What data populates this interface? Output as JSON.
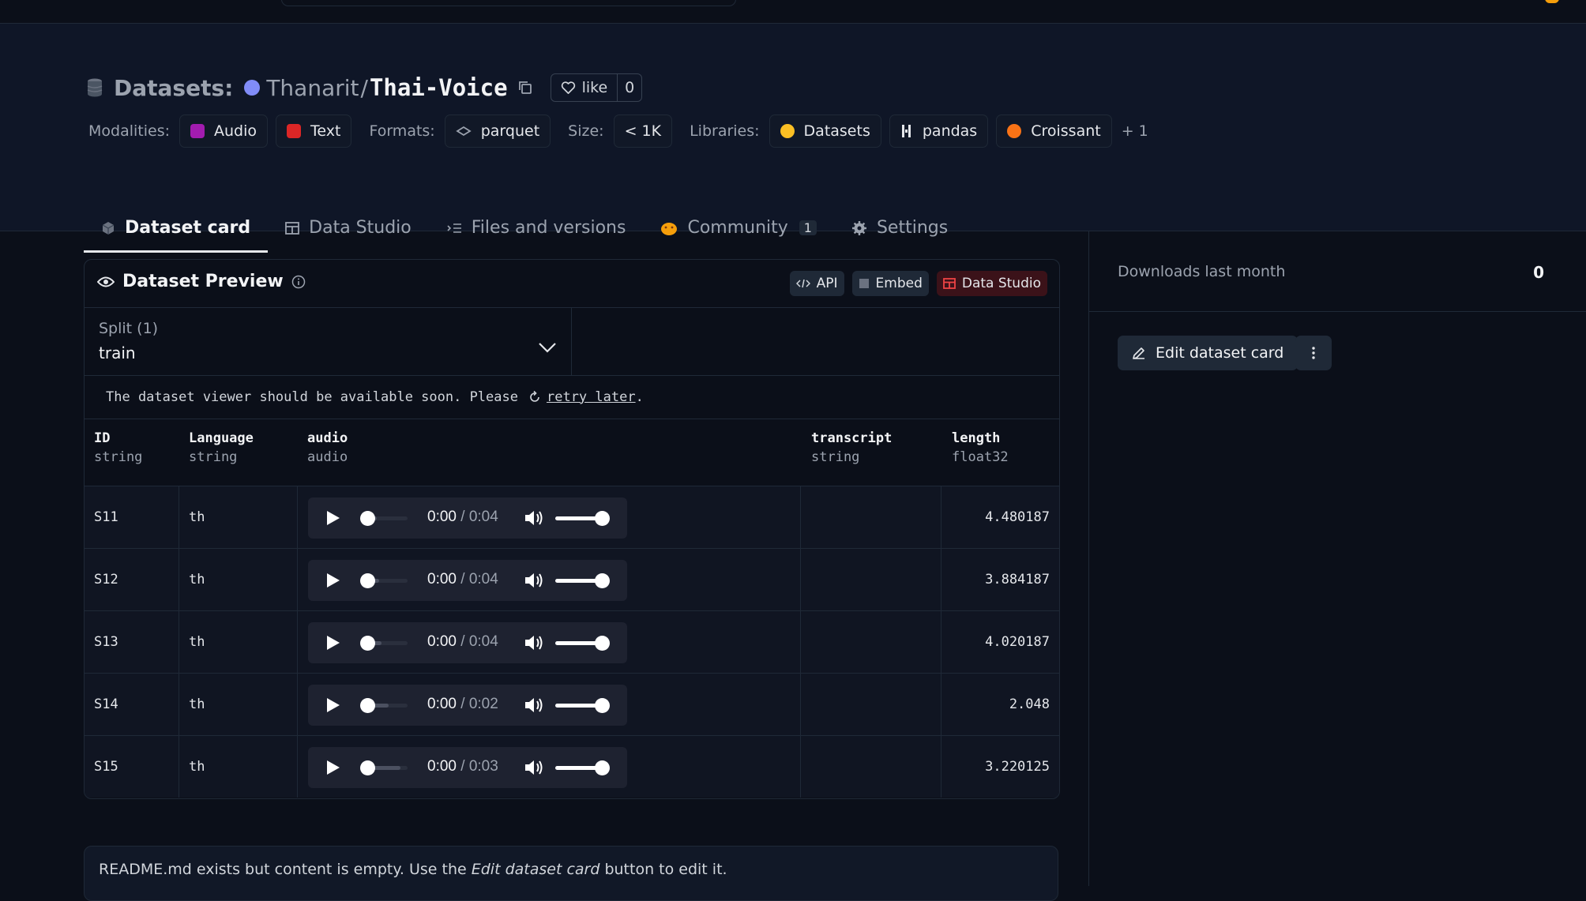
{
  "header": {
    "datasets_label": "Datasets:",
    "owner": "Thanarit",
    "separator": "/",
    "repo": "Thai-Voice",
    "like_label": "like",
    "like_count": "0"
  },
  "tags": {
    "modalities_label": "Modalities:",
    "modalities": [
      "Audio",
      "Text"
    ],
    "formats_label": "Formats:",
    "format": "parquet",
    "size_label": "Size:",
    "size": "< 1K",
    "libraries_label": "Libraries:",
    "libraries": [
      "Datasets",
      "pandas",
      "Croissant"
    ],
    "more": "+ 1"
  },
  "tabs": [
    {
      "label": "Dataset card",
      "active": true
    },
    {
      "label": "Data Studio"
    },
    {
      "label": "Files and versions"
    },
    {
      "label": "Community",
      "badge": "1"
    },
    {
      "label": "Settings"
    }
  ],
  "preview": {
    "title": "Dataset Preview",
    "api_label": "API",
    "embed_label": "Embed",
    "studio_label": "Data Studio",
    "split_label": "Split (1)",
    "split_value": "train",
    "notice_text": "The dataset viewer should be available soon. Please",
    "retry_text": "retry later",
    "notice_end": ".",
    "columns": [
      {
        "name": "ID",
        "type": "string"
      },
      {
        "name": "Language",
        "type": "string"
      },
      {
        "name": "audio",
        "type": "audio"
      },
      {
        "name": "transcript",
        "type": "string"
      },
      {
        "name": "length",
        "type": "float32"
      }
    ],
    "rows": [
      {
        "id": "S11",
        "lang": "th",
        "current": "0:00",
        "duration": "/ 0:04",
        "length": "4.480187",
        "buffered": 0.35
      },
      {
        "id": "S12",
        "lang": "th",
        "current": "0:00",
        "duration": "/ 0:04",
        "length": "3.884187",
        "buffered": 0.4
      },
      {
        "id": "S13",
        "lang": "th",
        "current": "0:00",
        "duration": "/ 0:04",
        "length": "4.020187",
        "buffered": 0.45
      },
      {
        "id": "S14",
        "lang": "th",
        "current": "0:00",
        "duration": "/ 0:02",
        "length": "2.048",
        "buffered": 0.6
      },
      {
        "id": "S15",
        "lang": "th",
        "current": "0:00",
        "duration": "/ 0:03",
        "length": "3.220125",
        "buffered": 0.85
      }
    ]
  },
  "readme": {
    "before": "README.md exists but content is empty. Use the",
    "emph": "Edit dataset card",
    "after": "button to edit it."
  },
  "sidebar": {
    "downloads_label": "Downloads last month",
    "downloads_value": "0",
    "edit_label": "Edit dataset card"
  },
  "colors": {
    "background": "#0b0f19",
    "accent_red": "#ef4444",
    "avatar": "#818cf8"
  }
}
